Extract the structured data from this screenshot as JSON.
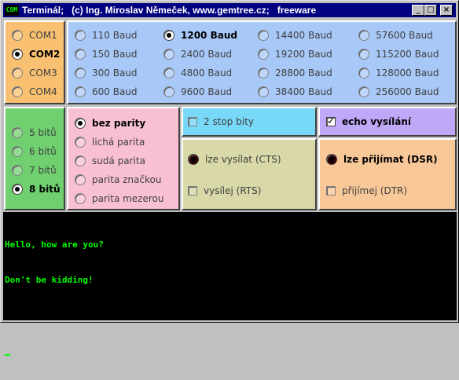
{
  "window": {
    "icon_label": "COM",
    "title": "Terminál;   (c) Ing. Miroslav Němeček, www.gemtree.cz;   freeware",
    "minimize": "_",
    "maximize": "□",
    "close": "×"
  },
  "ports": [
    {
      "label": "COM1",
      "selected": false
    },
    {
      "label": "COM2",
      "selected": true
    },
    {
      "label": "COM3",
      "selected": false
    },
    {
      "label": "COM4",
      "selected": false
    }
  ],
  "baud": [
    {
      "label": "110 Baud",
      "selected": false
    },
    {
      "label": "150 Baud",
      "selected": false
    },
    {
      "label": "300 Baud",
      "selected": false
    },
    {
      "label": "600 Baud",
      "selected": false
    },
    {
      "label": "1200 Baud",
      "selected": true
    },
    {
      "label": "2400 Baud",
      "selected": false
    },
    {
      "label": "4800 Baud",
      "selected": false
    },
    {
      "label": "9600 Baud",
      "selected": false
    },
    {
      "label": "14400 Baud",
      "selected": false
    },
    {
      "label": "19200 Baud",
      "selected": false
    },
    {
      "label": "28800 Baud",
      "selected": false
    },
    {
      "label": "38400 Baud",
      "selected": false
    },
    {
      "label": "57600 Baud",
      "selected": false
    },
    {
      "label": "115200 Baud",
      "selected": false
    },
    {
      "label": "128000 Baud",
      "selected": false
    },
    {
      "label": "256000 Baud",
      "selected": false
    }
  ],
  "bits": [
    {
      "label": "5 bitů",
      "selected": false
    },
    {
      "label": "6 bitů",
      "selected": false
    },
    {
      "label": "7 bitů",
      "selected": false
    },
    {
      "label": "8 bitů",
      "selected": true
    }
  ],
  "parity": [
    {
      "label": "bez parity",
      "selected": true
    },
    {
      "label": "lichá parita",
      "selected": false
    },
    {
      "label": "sudá parita",
      "selected": false
    },
    {
      "label": "parita značkou",
      "selected": false
    },
    {
      "label": "parita mezerou",
      "selected": false
    }
  ],
  "stop_bits": {
    "label": "2 stop bity",
    "checked": false
  },
  "echo": {
    "label": "echo vysílání",
    "checked": true
  },
  "cts": {
    "label": "lze vysílat (CTS)",
    "active": false
  },
  "rts": {
    "label": "vysílej (RTS)",
    "checked": false
  },
  "dsr": {
    "label": "lze přijímat (DSR)",
    "active": true
  },
  "dtr": {
    "label": "přijímej (DTR)",
    "checked": false
  },
  "terminal": {
    "lines": [
      "Hello, how are you?",
      "Don't be kidding!",
      ""
    ]
  },
  "colors": {
    "ports_panel": "#f8c070",
    "baud_panel": "#a8c8f8",
    "bits_panel": "#70d070",
    "parity_panel": "#f8c0d0",
    "stop_panel": "#78d8f8",
    "echo_panel": "#c0a8f8",
    "cts_panel": "#d8d8a8",
    "dsr_panel": "#f8c898",
    "terminal_text": "#00ff00"
  }
}
